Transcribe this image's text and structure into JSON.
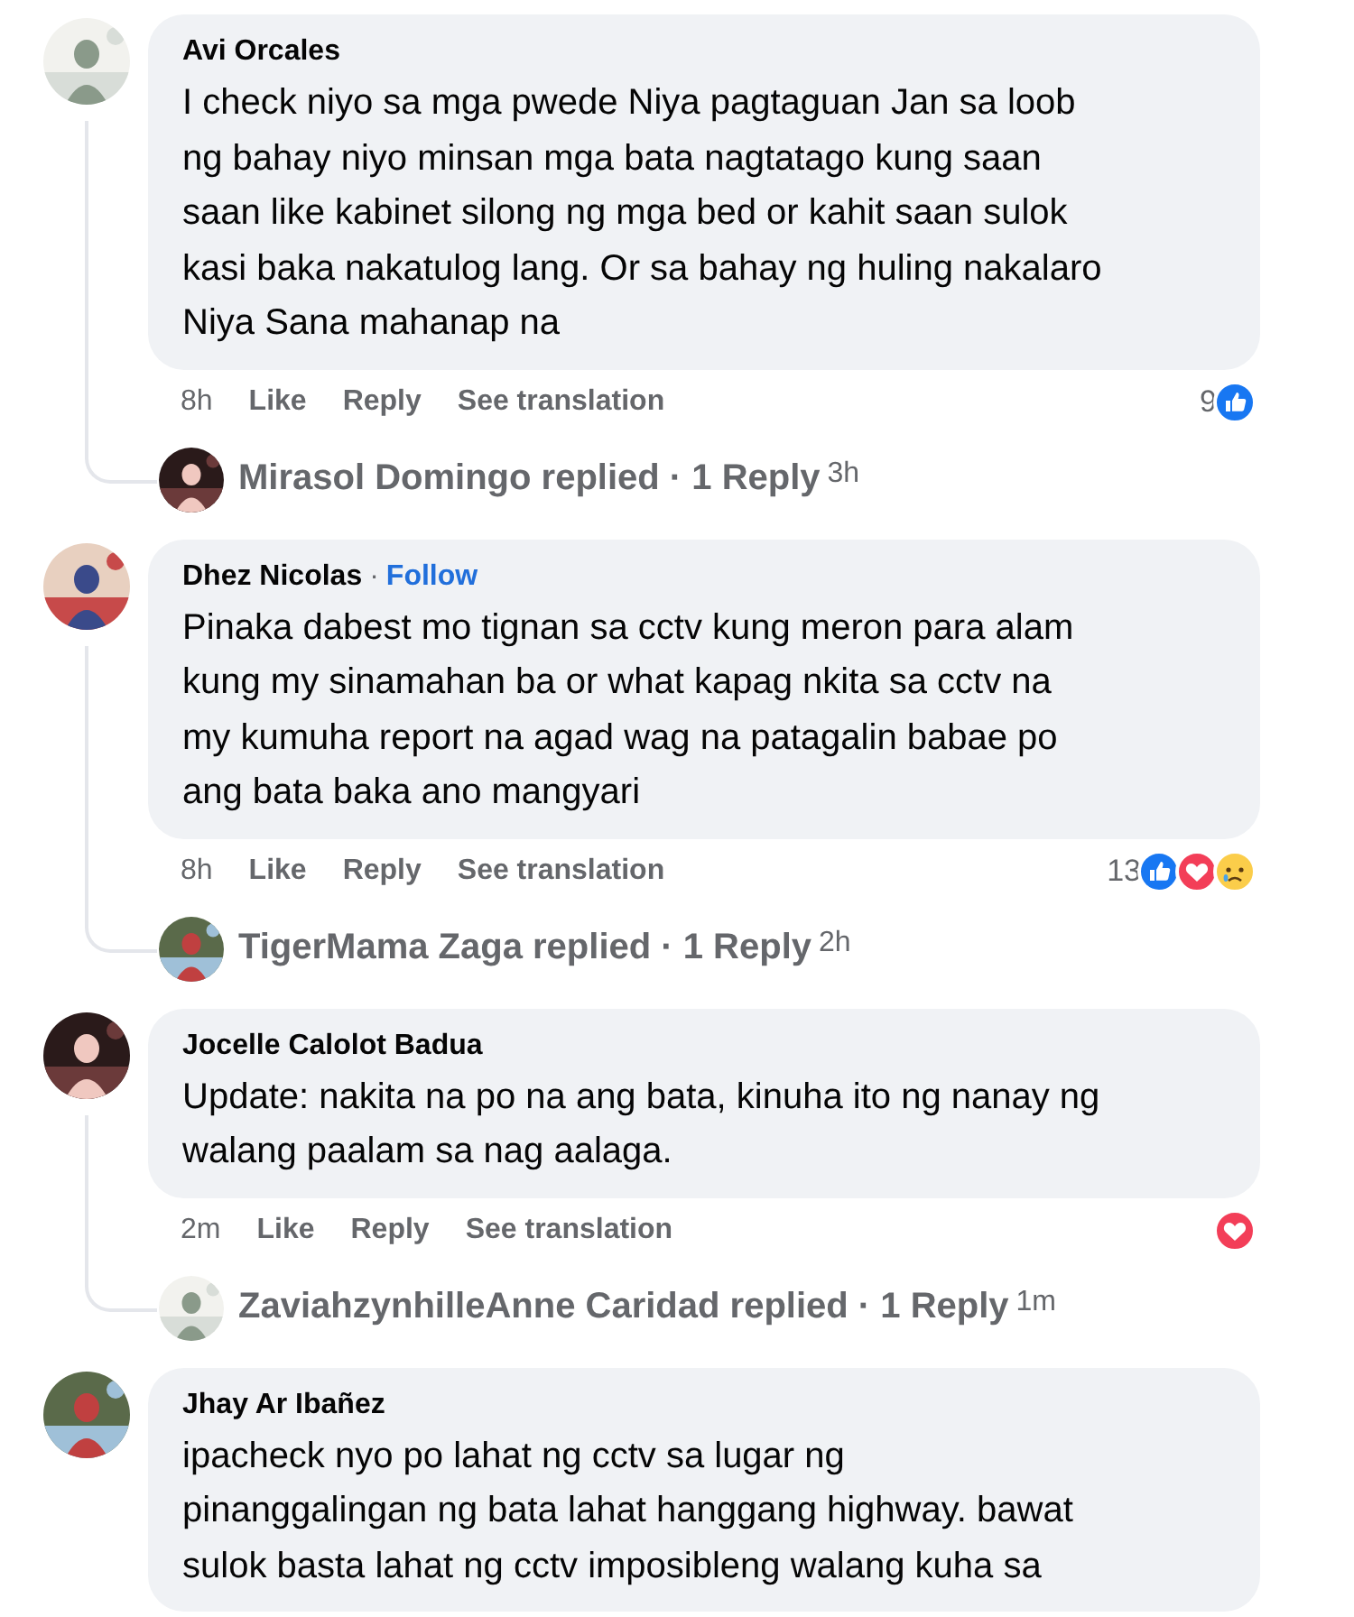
{
  "comments": [
    {
      "author": "Avi Orcales",
      "lines": [
        "I check niyo sa mga pwede Niya pagtaguan Jan sa loob",
        "ng bahay niyo minsan mga bata nagtatago kung saan",
        "saan like kabinet silong ng mga bed or kahit saan sulok",
        "kasi baka nakatulog lang. Or sa bahay ng huling nakalaro",
        "Niya Sana mahanap na"
      ],
      "time": "8h",
      "actions": [
        "Like",
        "Reply",
        "See translation"
      ],
      "reaction_count": "9",
      "reactions": [
        {
          "kind": "like"
        }
      ],
      "reply": {
        "text": "Mirasol Domingo replied · 1 Reply",
        "time": "3h"
      }
    },
    {
      "author": "Dhez Nicolas",
      "follow": {
        "separator": "·",
        "label": "Follow"
      },
      "lines": [
        "Pinaka dabest mo tignan sa cctv kung meron para alam",
        "kung my sinamahan ba or what kapag nkita sa cctv na",
        "my kumuha report na agad wag na patagalin babae po",
        "ang bata baka ano mangyari"
      ],
      "time": "8h",
      "actions": [
        "Like",
        "Reply",
        "See translation"
      ],
      "reaction_count": "13",
      "reactions": [
        {
          "kind": "like"
        },
        {
          "kind": "love"
        },
        {
          "kind": "sad"
        }
      ],
      "reply": {
        "text": "TigerMama Zaga replied · 1 Reply",
        "time": "2h"
      }
    },
    {
      "author": "Jocelle Calolot Badua",
      "lines": [
        "Update: nakita na po na ang bata, kinuha ito ng nanay ng",
        "walang paalam sa nag aalaga."
      ],
      "time": "2m",
      "actions": [
        "Like",
        "Reply",
        "See translation"
      ],
      "reactions": [
        {
          "kind": "love"
        }
      ],
      "reply": {
        "text": "ZaviahzynhilleAnne Caridad replied · 1 Reply",
        "time": "1m"
      }
    },
    {
      "author": "Jhay Ar Ibañez",
      "lines": [
        "ipacheck nyo po lahat ng cctv sa lugar ng",
        "pinanggalingan ng bata lahat hanggang highway. bawat",
        "sulok basta lahat ng cctv imposibleng walang kuha sa"
      ]
    }
  ]
}
